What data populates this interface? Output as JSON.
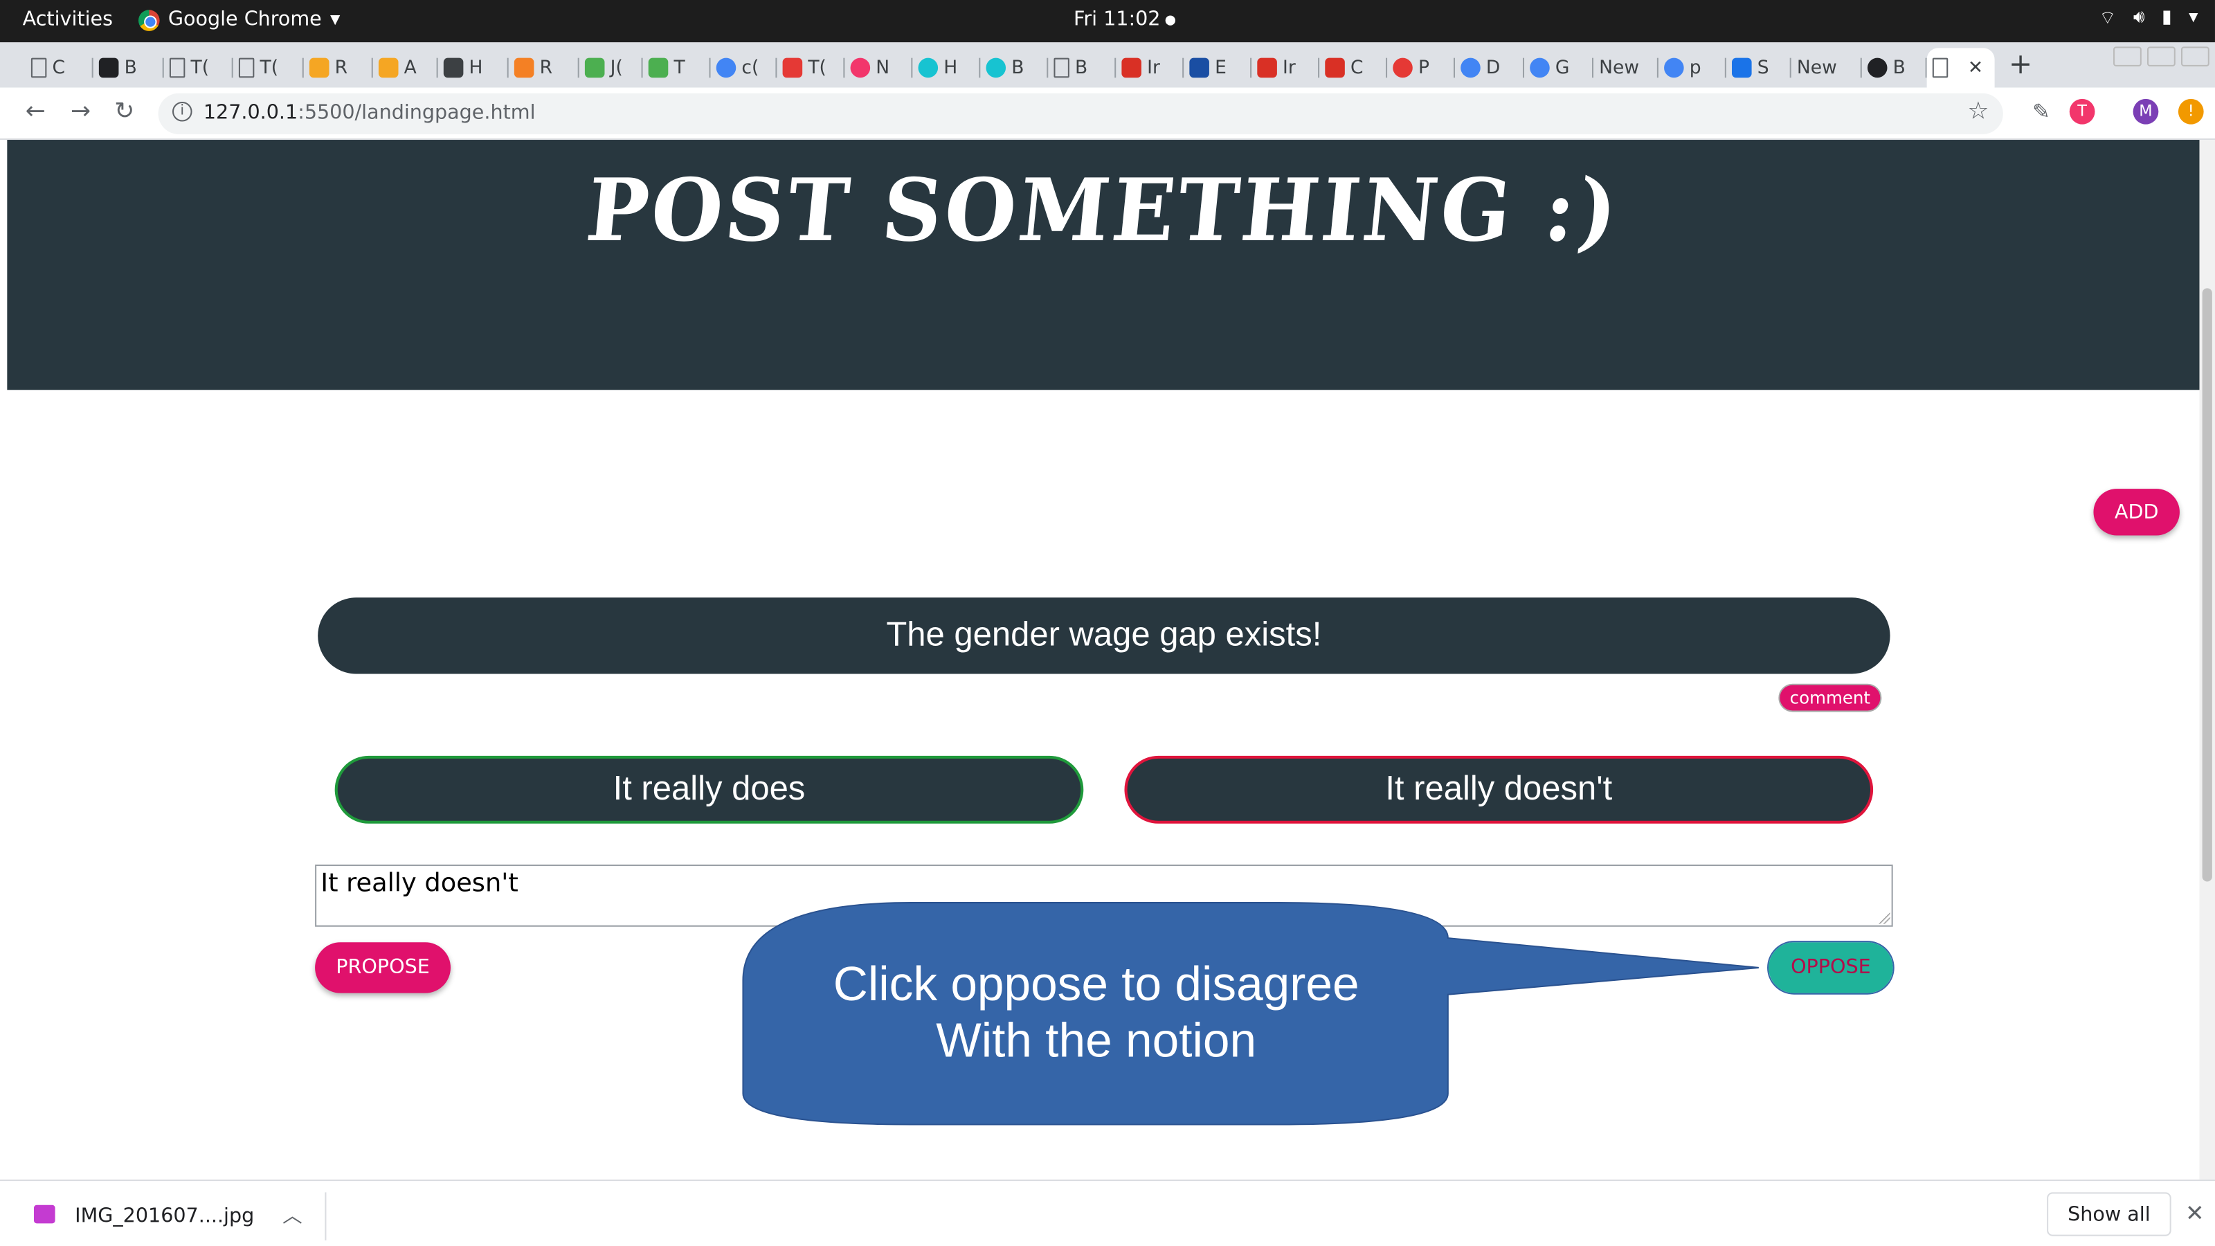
{
  "os_bar": {
    "activities": "Activities",
    "app_name": "Google Chrome",
    "clock": "Fri 11:02"
  },
  "tabs": [
    {
      "label": "C",
      "icon": "doc-icon",
      "color": "#5f6368"
    },
    {
      "label": "B",
      "icon": "codepen-icon",
      "color": "#202124"
    },
    {
      "label": "T(",
      "icon": "doc-icon",
      "color": "#5f6368"
    },
    {
      "label": "T(",
      "icon": "doc-icon",
      "color": "#5f6368"
    },
    {
      "label": "R",
      "icon": "firebase-icon",
      "color": "#f5a623"
    },
    {
      "label": "A",
      "icon": "firebase-icon",
      "color": "#f5a623"
    },
    {
      "label": "H",
      "icon": "id-icon",
      "color": "#3c4043"
    },
    {
      "label": "R",
      "icon": "stack-icon",
      "color": "#f48024"
    },
    {
      "label": "J(",
      "icon": "w3-icon",
      "color": "#4caf50"
    },
    {
      "label": "T",
      "icon": "w3-icon",
      "color": "#4caf50"
    },
    {
      "label": "c(",
      "icon": "google-icon",
      "color": "#4285f4"
    },
    {
      "label": "T(",
      "icon": "rainbow-icon",
      "color": "#e53935"
    },
    {
      "label": "N",
      "icon": "t-circle-icon",
      "color": "#f2366b"
    },
    {
      "label": "H",
      "icon": "c-circle-icon",
      "color": "#17c3d1"
    },
    {
      "label": "B",
      "icon": "c-circle-icon",
      "color": "#17c3d1"
    },
    {
      "label": "B",
      "icon": "doc-icon",
      "color": "#5f6368"
    },
    {
      "label": "Ir",
      "icon": "gmail-icon",
      "color": "#d93025"
    },
    {
      "label": "E",
      "icon": "wave-icon",
      "color": "#1a4ea3"
    },
    {
      "label": "Ir",
      "icon": "gmail-icon",
      "color": "#d93025"
    },
    {
      "label": "C",
      "icon": "gmail-icon",
      "color": "#d93025"
    },
    {
      "label": "P",
      "icon": "pinwheel-icon",
      "color": "#e53935"
    },
    {
      "label": "D",
      "icon": "google-icon",
      "color": "#4285f4"
    },
    {
      "label": "G",
      "icon": "google-icon",
      "color": "#4285f4"
    },
    {
      "label": "New",
      "icon": "",
      "color": ""
    },
    {
      "label": "p",
      "icon": "google-icon",
      "color": "#4285f4"
    },
    {
      "label": "S",
      "icon": "gear-icon",
      "color": "#1a73e8"
    },
    {
      "label": "New",
      "icon": "",
      "color": ""
    },
    {
      "label": "B",
      "icon": "github-icon",
      "color": "#202124"
    },
    {
      "label": "",
      "icon": "doc-icon",
      "color": "#5f6368",
      "active": true
    }
  ],
  "address_bar": {
    "url_host": "127.0.0.1",
    "url_rest": ":5500/landingpage.html"
  },
  "profile_initial": "M",
  "page": {
    "title": "POST SOMETHING :)",
    "add_button": "ADD",
    "topic": "The gender wage gap exists!",
    "comment_button": "comment",
    "pro_option": "It really does",
    "con_option": "It really doesn't",
    "input_value": "It really doesn't",
    "propose_button": "PROPOSE",
    "oppose_button": "OPPOSE"
  },
  "callout": {
    "line1": "Click oppose to disagree",
    "line2": "With the notion",
    "color": "#3565a8"
  },
  "downloads": {
    "file_name": "IMG_201607....jpg",
    "show_all": "Show all"
  },
  "colors": {
    "hero_bg": "#28373f",
    "accent_pink": "#e0116c",
    "oppose_teal": "#1fb39a",
    "pro_border": "#1f9a3b",
    "con_border": "#e0143c"
  }
}
